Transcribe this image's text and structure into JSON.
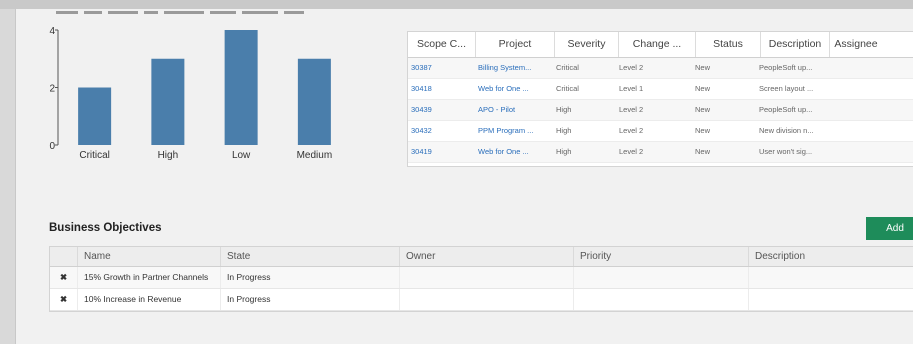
{
  "chart_data": {
    "type": "bar",
    "categories": [
      "Critical",
      "High",
      "Low",
      "Medium"
    ],
    "values": [
      2,
      3,
      4,
      3
    ],
    "ylim": [
      0,
      4
    ],
    "yticks": [
      0,
      2,
      4
    ],
    "bar_color": "#4a7eab"
  },
  "scope_table": {
    "columns": [
      "Scope C...",
      "Project",
      "Severity",
      "Change ...",
      "Status",
      "Description",
      "Assignee"
    ],
    "rows": [
      [
        "30387",
        "Billing System...",
        "Critical",
        "Level 2",
        "New",
        "PeopleSoft up...",
        ""
      ],
      [
        "30418",
        "Web for One ...",
        "Critical",
        "Level 1",
        "New",
        "Screen layout ...",
        ""
      ],
      [
        "30439",
        "APO - Pilot",
        "High",
        "Level 2",
        "New",
        "PeopleSoft up...",
        ""
      ],
      [
        "30432",
        "PPM Program ...",
        "High",
        "Level 2",
        "New",
        "New division n...",
        ""
      ],
      [
        "30419",
        "Web for One ...",
        "High",
        "Level 2",
        "New",
        "User won't sig...",
        ""
      ]
    ]
  },
  "business_objectives": {
    "title": "Business Objectives",
    "add_label": "Add",
    "columns": [
      "Name",
      "State",
      "Owner",
      "Priority",
      "Description"
    ],
    "rows": [
      {
        "delete": "✖",
        "name": "15% Growth in Partner Channels",
        "state": "In Progress",
        "owner": "",
        "priority": "",
        "description": ""
      },
      {
        "delete": "✖",
        "name": "10% Increase in Revenue",
        "state": "In Progress",
        "owner": "",
        "priority": "",
        "description": ""
      }
    ]
  },
  "colors": {
    "accent_green": "#1e8c5a",
    "link_blue": "#2a6ebb",
    "delete_red": "#d9252a"
  }
}
